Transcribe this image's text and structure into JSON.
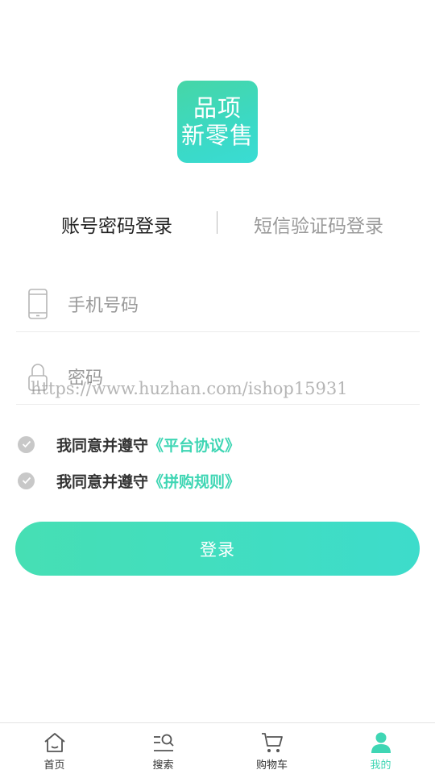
{
  "logo": {
    "line1": "品项",
    "line2": "新零售"
  },
  "tabs": [
    {
      "label": "账号密码登录",
      "active": true
    },
    {
      "label": "短信验证码登录",
      "active": false
    }
  ],
  "form": {
    "phone": {
      "value": "",
      "placeholder": "手机号码",
      "icon": "phone-icon"
    },
    "password": {
      "value": "",
      "placeholder": "密码",
      "icon": "lock-icon"
    }
  },
  "watermark": "https://www.huzhan.com/ishop15931",
  "agreements": [
    {
      "text": "我同意并遵守",
      "link": "《平台协议》"
    },
    {
      "text": "我同意并遵守",
      "link": "《拼购规则》"
    }
  ],
  "login_button": "登录",
  "bottom_nav": [
    {
      "label": "首页",
      "icon": "home-icon",
      "active": false
    },
    {
      "label": "搜索",
      "icon": "search-icon",
      "active": false
    },
    {
      "label": "购物车",
      "icon": "cart-icon",
      "active": false
    },
    {
      "label": "我的",
      "icon": "user-icon",
      "active": true
    }
  ],
  "colors": {
    "accent": "#3fd6b4",
    "check_gray": "#c8c8c8",
    "text": "#333333",
    "muted": "#9a9a9a"
  }
}
